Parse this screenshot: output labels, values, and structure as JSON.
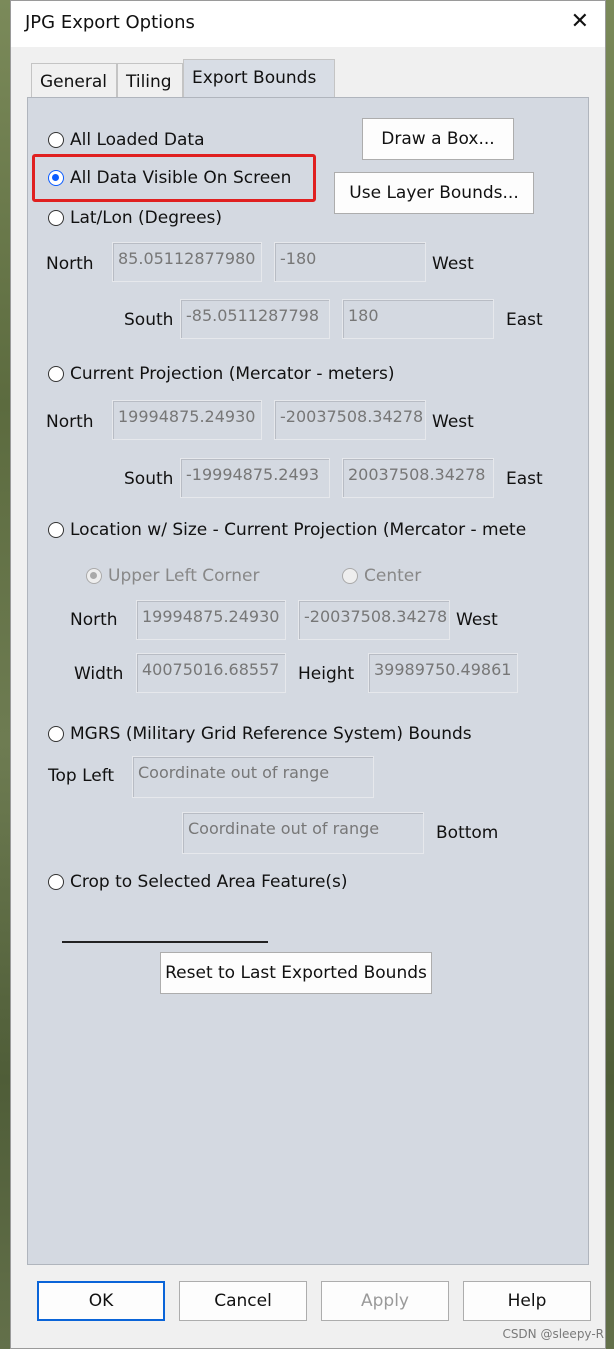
{
  "window": {
    "title": "JPG Export Options",
    "close_glyph": "✕"
  },
  "tabs": [
    {
      "label": "General"
    },
    {
      "label": "Tiling"
    },
    {
      "label": "Export Bounds"
    }
  ],
  "options": {
    "all_loaded": "All Loaded Data",
    "all_visible": "All Data Visible On Screen",
    "latlon": "Lat/Lon (Degrees)",
    "current_proj": "Current Projection (Mercator - meters)",
    "location_size": "Location w/ Size - Current Projection (Mercator - mete",
    "mgrs": "MGRS (Military Grid Reference System) Bounds",
    "crop": "Crop to Selected Area Feature(s)"
  },
  "buttons": {
    "draw_box": "Draw a Box...",
    "layer_bounds": "Use Layer Bounds...",
    "reset": "Reset to Last Exported Bounds",
    "ok": "OK",
    "cancel": "Cancel",
    "apply": "Apply",
    "help": "Help"
  },
  "labels": {
    "north": "North",
    "south": "South",
    "west": "West",
    "east": "East",
    "width": "Width",
    "height": "Height",
    "top_left": "Top Left",
    "bottom": "Bottom",
    "upper_left": "Upper Left Corner",
    "center": "Center"
  },
  "latlon": {
    "north": "85.05112877980",
    "west": "-180",
    "south": "-85.0511287798",
    "east": "180"
  },
  "proj": {
    "north": "19994875.24930",
    "west": "-20037508.34278",
    "south": "-19994875.2493",
    "east": "20037508.34278"
  },
  "loc": {
    "north": "19994875.24930",
    "west": "-20037508.34278",
    "width": "40075016.68557",
    "height": "39989750.49861"
  },
  "mgrs": {
    "top_left": "Coordinate out of range",
    "bottom": "Coordinate out of range"
  },
  "watermark": "CSDN @sleepy-R",
  "colors": {
    "highlight": "#e02020",
    "accent": "#0b5cff"
  }
}
